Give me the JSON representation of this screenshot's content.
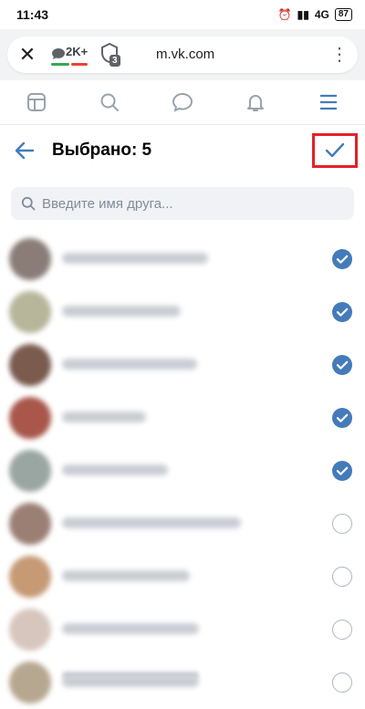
{
  "status_bar": {
    "time": "11:43",
    "network": "4G",
    "battery": "87"
  },
  "browser": {
    "close_icon": "close-icon",
    "comments_count": "2K+",
    "tabs_count": "3",
    "url": "m.vk.com",
    "menu_icon": "more-vert-icon"
  },
  "vk_nav": {
    "items": [
      "news-icon",
      "search-icon",
      "messages-icon",
      "notifications-icon",
      "menu-icon"
    ],
    "active_color": "#447bba",
    "inactive_color": "#99a2ad"
  },
  "header": {
    "title": "Выбрано: 5",
    "confirm_icon": "checkmark-icon"
  },
  "search": {
    "placeholder": "Введите имя друга..."
  },
  "friends": [
    {
      "name": "Александр Кузнецов",
      "selected": true,
      "avatar_color": "#8a7d78"
    },
    {
      "name": "Ольга Петрова",
      "selected": true,
      "avatar_color": "#b7b59a"
    },
    {
      "name": "Игорь Тарасенко",
      "selected": true,
      "avatar_color": "#7a5b4e"
    },
    {
      "name": "Анна Ким",
      "selected": true,
      "avatar_color": "#a8574a"
    },
    {
      "name": "Мария Лисицина",
      "selected": true,
      "avatar_color": "#9aa6a2"
    },
    {
      "name": "Дмитрий Шарапов",
      "selected": false,
      "avatar_color": "#9b7f75"
    },
    {
      "name": "Елена Сидорова",
      "selected": false,
      "avatar_color": "#c69a75"
    },
    {
      "name": "Сергей Волков",
      "selected": false,
      "avatar_color": "#d7c6bd"
    },
    {
      "name": "Наталья Ковалёва",
      "selected": false,
      "avatar_color": "#b6a790"
    }
  ],
  "colors": {
    "accent": "#447bba",
    "highlight_box": "#e4202a"
  }
}
